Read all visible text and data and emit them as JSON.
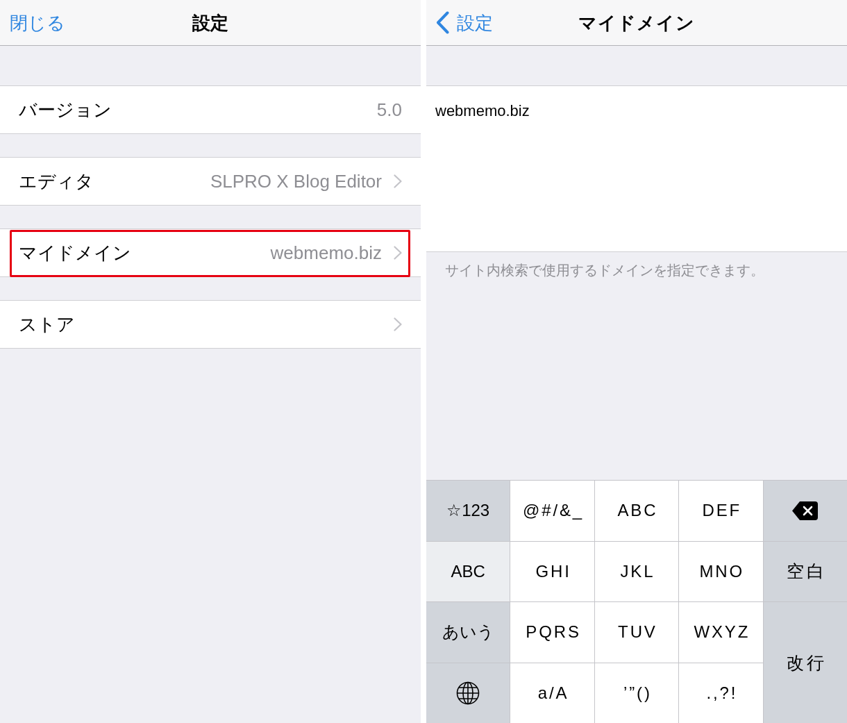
{
  "left_screen": {
    "nav": {
      "close_button": "閉じる",
      "title": "設定"
    },
    "rows": [
      {
        "label": "バージョン",
        "value": "5.0",
        "disclosure": false,
        "highlighted": false
      },
      {
        "label": "エディタ",
        "value": "SLPRO X Blog Editor",
        "disclosure": true,
        "highlighted": false
      },
      {
        "label": "マイドメイン",
        "value": "webmemo.biz",
        "disclosure": true,
        "highlighted": true
      },
      {
        "label": "ストア",
        "disclosure": true,
        "highlighted": false
      }
    ]
  },
  "right_screen": {
    "nav": {
      "back_button": "設定",
      "title": "マイドメイン"
    },
    "text_area": {
      "value": "webmemo.biz"
    },
    "footer": "サイト内検索で使用するドメインを指定できます。",
    "keyboard": {
      "keys": [
        {
          "kind": "mode",
          "label": "☆123",
          "selected": false
        },
        {
          "kind": "char",
          "label": "@#/&_"
        },
        {
          "kind": "char",
          "label": "ABC"
        },
        {
          "kind": "char",
          "label": "DEF"
        },
        {
          "kind": "backspace"
        },
        {
          "kind": "mode",
          "label": "ABC",
          "selected": true
        },
        {
          "kind": "char",
          "label": "GHI"
        },
        {
          "kind": "char",
          "label": "JKL"
        },
        {
          "kind": "char",
          "label": "MNO"
        },
        {
          "kind": "space",
          "label": "空白"
        },
        {
          "kind": "mode",
          "label": "あいう",
          "selected": false
        },
        {
          "kind": "char",
          "label": "PQRS"
        },
        {
          "kind": "char",
          "label": "TUV"
        },
        {
          "kind": "char",
          "label": "WXYZ"
        },
        {
          "kind": "return",
          "label": "改行"
        },
        {
          "kind": "globe"
        },
        {
          "kind": "char",
          "label": "a/A"
        },
        {
          "kind": "char",
          "label": "’”()"
        },
        {
          "kind": "char",
          "label": ".,?!"
        }
      ]
    }
  }
}
